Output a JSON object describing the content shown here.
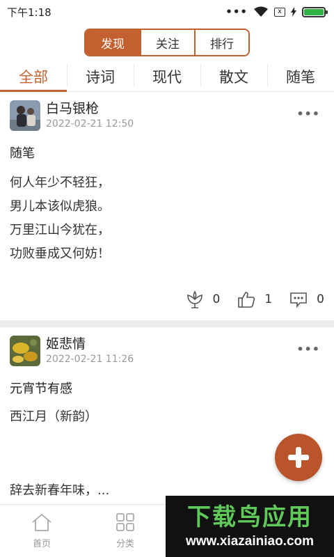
{
  "status": {
    "time": "下午1:18",
    "dots": "•••",
    "sim_label": "x"
  },
  "segment": {
    "items": [
      "发现",
      "关注",
      "排行"
    ],
    "active": 0
  },
  "tabs": [
    "全部",
    "诗词",
    "现代",
    "散文",
    "随笔"
  ],
  "posts": [
    {
      "author": "白马银枪",
      "time": "2022-02-21 12:50",
      "more": "•••",
      "title": "随笔",
      "lines": [
        "何人年少不轻狂，",
        "男儿本该似虎狼。",
        "万里江山今犹在，",
        "功败垂成又何妨！"
      ],
      "flowers": "0",
      "likes": "1",
      "comments": "0"
    },
    {
      "author": "姬悲情",
      "time": "2022-02-21 11:26",
      "more": "•••",
      "title": "元宵节有感",
      "body": "西江月（新韵）",
      "excerpt": "辞去新春年味，..."
    }
  ],
  "bottom_nav": [
    {
      "label": "首页",
      "icon": "home-icon"
    },
    {
      "label": "分类",
      "icon": "grid-icon"
    }
  ],
  "watermark": {
    "title": "下载鸟应用",
    "url": "www.xiazainiao.com"
  },
  "colors": {
    "accent": "#c2612f",
    "fab": "#b9542b",
    "watermark_green": "#5fc95a"
  }
}
